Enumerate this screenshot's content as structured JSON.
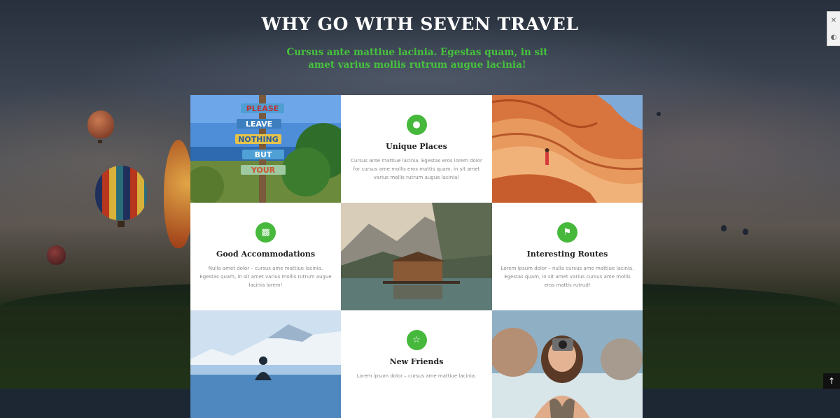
{
  "section": {
    "title": "WHY GO WITH SEVEN TRAVEL",
    "subtitle": "Cursus ante mattiue lacinia. Egestas quam, in sit amet varius mollis rutrum augue lacinia!"
  },
  "features": [
    {
      "icon": "globe-icon",
      "title": "Unique Places",
      "text": "Cursus ante mattiue lacinia. Egestas eros lorem dolor for cursus ame mollis eros mattis quam, in sit amet varius mollis rutrum augue lacinia!"
    },
    {
      "icon": "bed-icon",
      "title": "Good Accommodations",
      "text": "Nulla amet dolor – cursus ame mattiue lacinia. Egestas quam, in sit amet varius mollis rutrum augue lacinia lorem!"
    },
    {
      "icon": "signpost-icon",
      "title": "Interesting Routes",
      "text": "Lorem ipsum dolor – nulla cursus ame mattiue lacinia. Egestas quam, in sit amet varius cursus ame mollis eros mattis rutrud!"
    },
    {
      "icon": "handshake-icon",
      "title": "New Friends",
      "text": "Lorem ipsum dolor – cursus ame mattiue lacinia."
    }
  ],
  "photo_sign": {
    "lines": [
      "PLEASE",
      "LEAVE",
      "NOTHING",
      "BUT",
      "YOUR"
    ]
  },
  "colors": {
    "accent": "#46b83c",
    "subtitle": "#46c33d"
  },
  "ui": {
    "tool_1": "✕",
    "tool_2": "◐",
    "to_top": "↑"
  }
}
